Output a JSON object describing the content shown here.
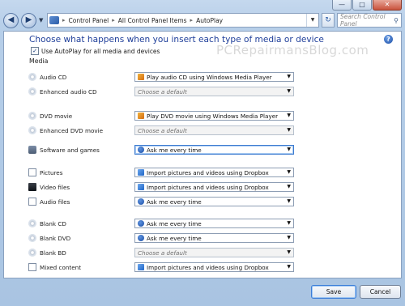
{
  "window": {
    "minimize": "—",
    "maximize": "□",
    "close": "✕"
  },
  "address_bar": {
    "crumbs": [
      "Control Panel",
      "All Control Panel Items",
      "AutoPlay"
    ],
    "search_placeholder": "Search Control Panel"
  },
  "page": {
    "heading": "Choose what happens when you insert each type of media or device",
    "use_autoplay_label": "Use AutoPlay for all media and devices",
    "use_autoplay_checked": true,
    "section_media": "Media",
    "watermark": "PCRepairmansBlog.com"
  },
  "rows": [
    {
      "label": "Audio CD",
      "icon": "cd-icon",
      "value": "Play audio CD using Windows Media Player",
      "value_icon": "play-icon",
      "placeholder": false
    },
    {
      "label": "Enhanced audio CD",
      "icon": "cd-icon",
      "value": "Choose a default",
      "value_icon": "",
      "placeholder": true
    },
    {
      "label": "DVD movie",
      "icon": "dvd-icon",
      "value": "Play DVD movie using Windows Media Player",
      "value_icon": "play-icon",
      "placeholder": false
    },
    {
      "label": "Enhanced DVD movie",
      "icon": "dvd-icon",
      "value": "Choose a default",
      "value_icon": "",
      "placeholder": true
    },
    {
      "label": "Software and games",
      "icon": "software-icon",
      "value": "Ask me every time",
      "value_icon": "ask-icon",
      "placeholder": false,
      "highlight": true
    },
    {
      "label": "Pictures",
      "icon": "pictures-icon",
      "value": "Import pictures and videos using Dropbox",
      "value_icon": "dropbox-icon",
      "placeholder": false
    },
    {
      "label": "Video files",
      "icon": "video-icon",
      "value": "Import pictures and videos using Dropbox",
      "value_icon": "dropbox-icon",
      "placeholder": false
    },
    {
      "label": "Audio files",
      "icon": "audio-file-icon",
      "value": "Ask me every time",
      "value_icon": "ask-icon",
      "placeholder": false
    },
    {
      "label": "Blank CD",
      "icon": "cd-icon",
      "value": "Ask me every time",
      "value_icon": "ask-icon",
      "placeholder": false
    },
    {
      "label": "Blank DVD",
      "icon": "dvd-icon",
      "value": "Ask me every time",
      "value_icon": "ask-icon",
      "placeholder": false
    },
    {
      "label": "Blank BD",
      "icon": "bd-icon",
      "value": "Choose a default",
      "value_icon": "",
      "placeholder": true
    },
    {
      "label": "Mixed content",
      "icon": "mixed-content-icon",
      "value": "Import pictures and videos using Dropbox",
      "value_icon": "dropbox-icon",
      "placeholder": false
    }
  ],
  "buttons": {
    "save": "Save",
    "cancel": "Cancel"
  }
}
